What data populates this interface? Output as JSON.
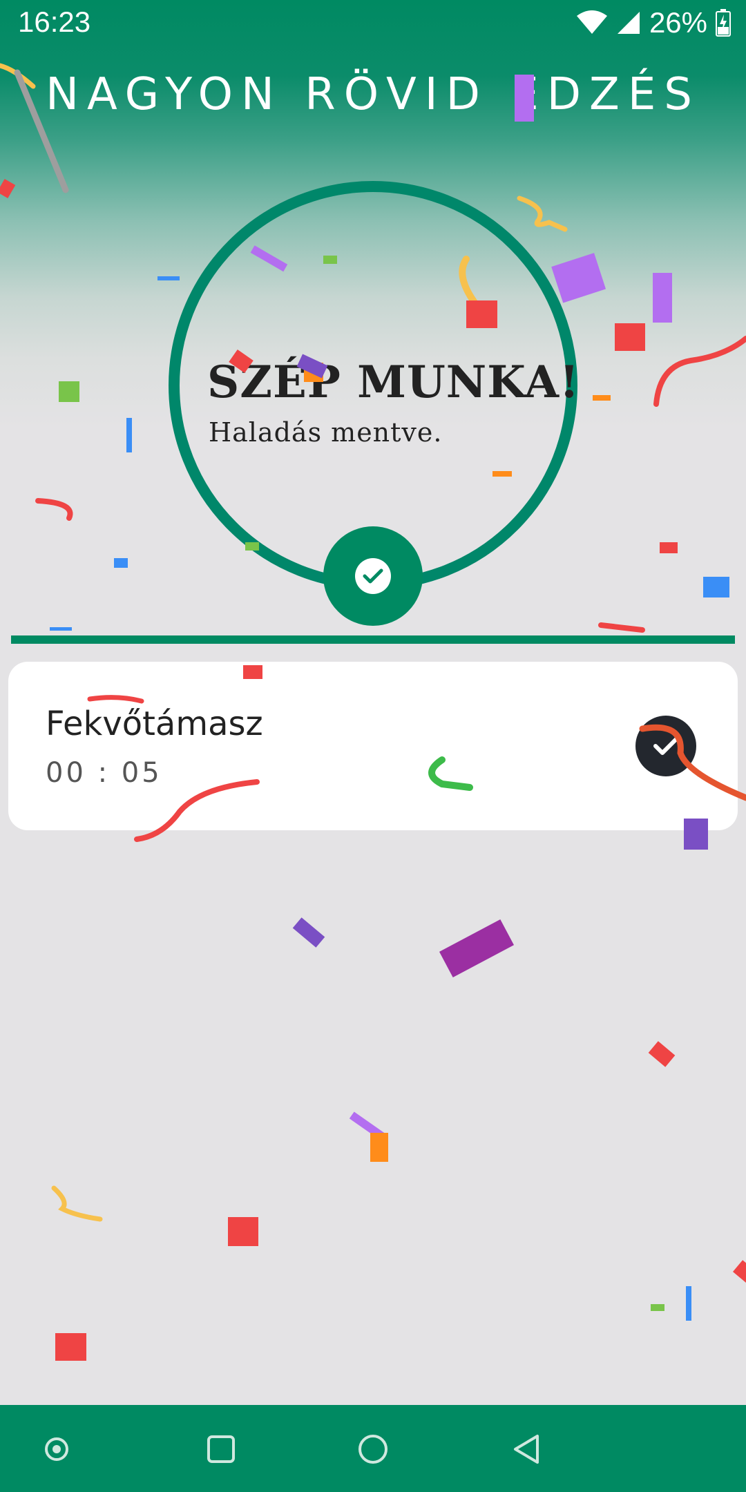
{
  "status_bar": {
    "time": "16:23",
    "battery": "26%",
    "icons": [
      "wifi-icon",
      "cell-signal-icon",
      "battery-charging-icon"
    ]
  },
  "workout": {
    "title": "NAGYON RÖVID EDZÉS"
  },
  "completion": {
    "headline": "SZÉP MUNKA!",
    "subtitle": "Haladás mentve.",
    "icon": "check-circle-icon"
  },
  "exercises": [
    {
      "name": "Fekvőtámasz",
      "duration": "00 : 05",
      "completed": true
    }
  ],
  "nav_bar": {
    "buttons": [
      "dot-icon",
      "recents-icon",
      "home-icon",
      "back-icon"
    ]
  },
  "colors": {
    "accent": "#008a62",
    "ring": "#00876a",
    "background": "#e4e3e5",
    "card": "#ffffff",
    "check_dark": "#23272e"
  }
}
